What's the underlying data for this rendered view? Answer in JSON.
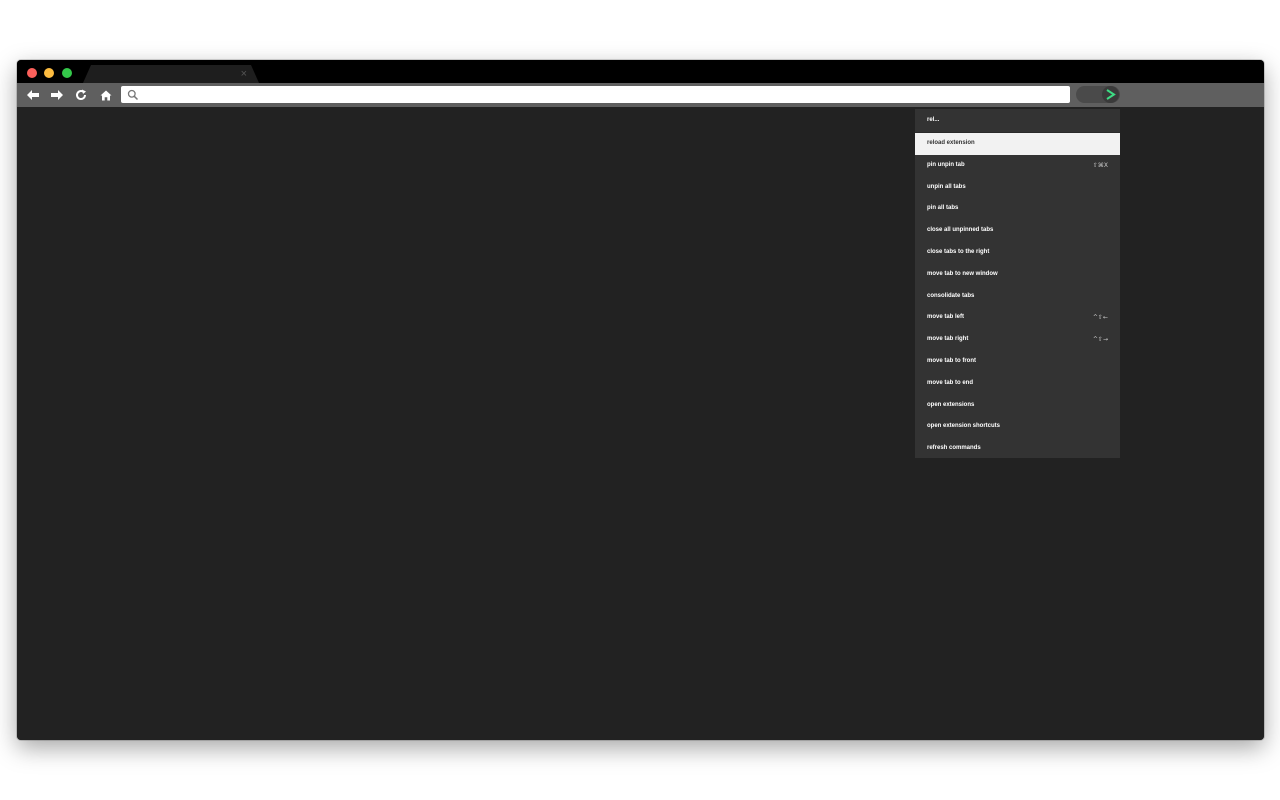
{
  "browser": {
    "tab_close_glyph": "×"
  },
  "omnibox": {
    "value": "",
    "placeholder": ""
  },
  "palette": {
    "query": "rel...",
    "selected_index": 0,
    "commands": [
      {
        "label": "reload extension",
        "shortcut": ""
      },
      {
        "label": "pin unpin tab",
        "shortcut": "⇧⌘X"
      },
      {
        "label": "unpin all tabs",
        "shortcut": ""
      },
      {
        "label": "pin all tabs",
        "shortcut": ""
      },
      {
        "label": "close all unpinned tabs",
        "shortcut": ""
      },
      {
        "label": "close tabs to the right",
        "shortcut": ""
      },
      {
        "label": "move tab to new window",
        "shortcut": ""
      },
      {
        "label": "consolidate tabs",
        "shortcut": ""
      },
      {
        "label": "move tab left",
        "shortcut": "^⇧←"
      },
      {
        "label": "move tab right",
        "shortcut": "^⇧→"
      },
      {
        "label": "move tab to front",
        "shortcut": ""
      },
      {
        "label": "move tab to end",
        "shortcut": ""
      },
      {
        "label": "open extensions",
        "shortcut": ""
      },
      {
        "label": "open extension shortcuts",
        "shortcut": ""
      },
      {
        "label": "refresh commands",
        "shortcut": ""
      }
    ]
  },
  "icons": {
    "back": "arrow-left-icon",
    "forward": "arrow-right-icon",
    "reload": "reload-icon",
    "home": "home-icon",
    "search": "search-icon",
    "extension": "chevron-right-icon"
  },
  "colors": {
    "window_bg": "#222222",
    "toolbar_bg": "#5f5f5f",
    "palette_bg": "#333333",
    "selected_bg": "#f2f2f2",
    "extension_accent": "#3ddc84"
  }
}
